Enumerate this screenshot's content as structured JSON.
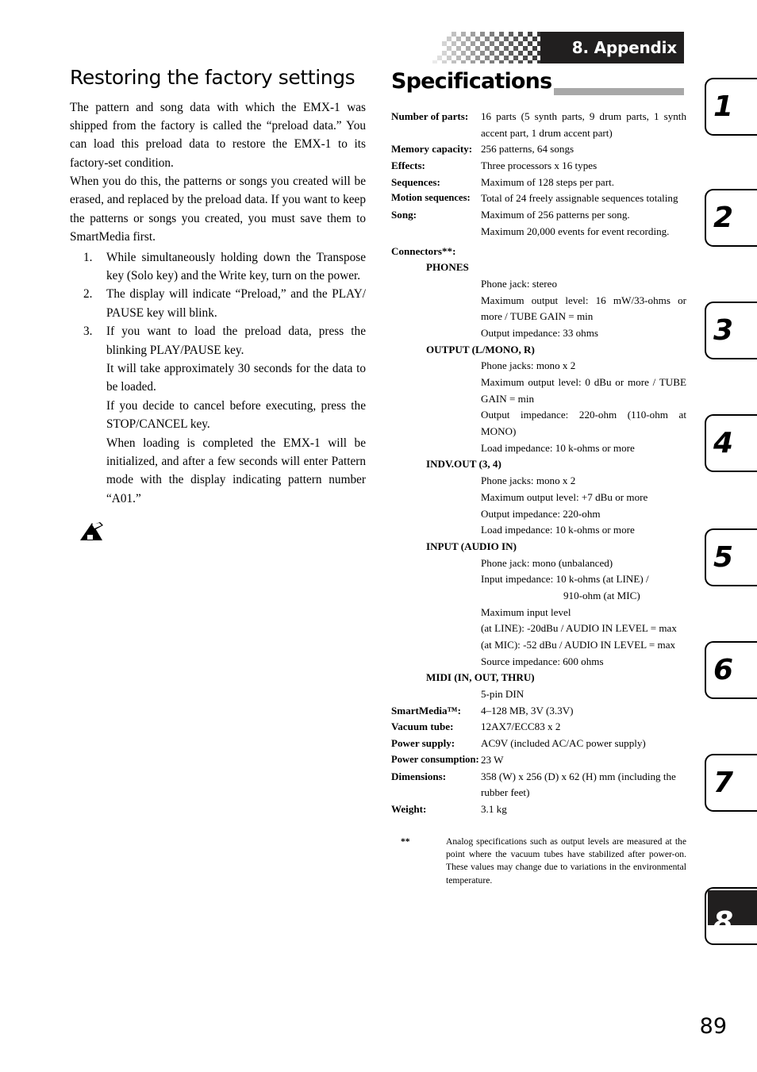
{
  "page": {
    "number": "89"
  },
  "chapter_banner": {
    "title": "8. Appendix"
  },
  "left_column": {
    "heading": "Restoring the factory settings",
    "paragraphs": [
      "The pattern and song data with which the EMX-1 was shipped from the factory is called the “preload data.” You can load this preload data to restore the EMX-1 to its factory-set condition.",
      "When you do this, the patterns or songs you created will be erased, and replaced by the preload data. If you want to keep the patterns or songs you created, you must save them to SmartMedia first."
    ],
    "steps": [
      {
        "num": "1.",
        "text": "While simultaneously holding down the Transpose key (Solo key) and the Write key, turn on the power.",
        "sub": []
      },
      {
        "num": "2.",
        "text": "The display will indicate “Preload,” and the PLAY/ PAUSE key will blink.",
        "sub": []
      },
      {
        "num": "3.",
        "text": "If you want to load the preload data, press the blinking PLAY/PAUSE key.",
        "sub": [
          "It will take approximately 30 seconds for the data to be loaded.",
          "If you decide to cancel before executing, press the STOP/CANCEL key.",
          "When loading is completed the EMX-1 will be initialized, and after a few seconds will enter Pattern mode with the display indicating pattern number “A01.”"
        ]
      }
    ],
    "note_icon": "pen-note-icon"
  },
  "right_column": {
    "title": "Specifications",
    "spec_rows": [
      {
        "label": "Number of parts:",
        "value": "16 parts (5 synth parts, 9 drum parts, 1 synth accent part, 1 drum accent part)"
      },
      {
        "label": "Memory capacity:",
        "value": "256 patterns, 64 songs"
      },
      {
        "label": "Effects:",
        "value": "Three processors x 16 types"
      },
      {
        "label": "Sequences:",
        "value": "Maximum of 128 steps per part."
      },
      {
        "label": "Motion sequences:",
        "value": "Total of 24 freely assignable sequences totaling"
      },
      {
        "label": "Song:",
        "value": "Maximum of 256 patterns per song.",
        "continuation": "Maximum 20,000 events for event recording."
      }
    ],
    "connectors_label": "Connectors**:",
    "connectors": [
      {
        "name": "PHONES",
        "details": [
          "Phone jack: stereo",
          "Maximum output level: 16 mW/33-ohms or more / TUBE GAIN = min",
          "Output impedance: 33 ohms"
        ]
      },
      {
        "name": "OUTPUT (L/MONO, R)",
        "details": [
          "Phone jacks: mono x 2",
          "Maximum output level: 0 dBu or more / TUBE GAIN = min",
          "Output impedance: 220-ohm (110-ohm at MONO)",
          "Load impedance: 10 k-ohms or more"
        ]
      },
      {
        "name": "INDV.OUT (3, 4)",
        "details": [
          "Phone jacks: mono x 2",
          "Maximum output level: +7 dBu or more",
          "Output impedance: 220-ohm",
          "Load impedance: 10 k-ohms or more"
        ]
      },
      {
        "name": "INPUT (AUDIO IN)",
        "details": [
          "Phone jack: mono (unbalanced)",
          "Input impedance: 10 k-ohms (at LINE) /"
        ],
        "detail_indent": "910-ohm (at MIC)",
        "details_after": [
          "Maximum input level",
          "(at LINE): -20dBu / AUDIO IN LEVEL = max",
          "(at MIC):   -52 dBu / AUDIO IN LEVEL = max",
          "Source impedance: 600 ohms"
        ]
      },
      {
        "name": "MIDI (IN, OUT, THRU)",
        "details": [
          "5-pin DIN"
        ]
      }
    ],
    "spec_rows_tail": [
      {
        "label": "SmartMedia™:",
        "value": "4–128 MB, 3V (3.3V)"
      },
      {
        "label": "Vacuum tube:",
        "value": "12AX7/ECC83 x 2"
      },
      {
        "label": "Power supply:",
        "value": "AC9V (included AC/AC power supply)"
      },
      {
        "label": "Power consumption:",
        "value": "23 W"
      },
      {
        "label": "Dimensions:",
        "value": "358 (W) x 256 (D) x 62 (H) mm (including the",
        "continuation": "rubber feet)"
      },
      {
        "label": "Weight:",
        "value": "3.1 kg"
      }
    ],
    "footnote": {
      "mark": "**",
      "text": "Analog specifications such as output levels are measured at the point where the vacuum tubes have stabilized after power-on. These values may change due to variations in the environmental temperature."
    }
  },
  "chapter_tabs": [
    {
      "label": "1",
      "active": false
    },
    {
      "label": "2",
      "active": false
    },
    {
      "label": "3",
      "active": false
    },
    {
      "label": "4",
      "active": false
    },
    {
      "label": "5",
      "active": false
    },
    {
      "label": "6",
      "active": false
    },
    {
      "label": "7",
      "active": false
    },
    {
      "label": "8",
      "active": true
    }
  ],
  "colors": {
    "bar_black": "#211f1f",
    "rule_gray": "#a8a8a8",
    "page_bg": "#ffffff"
  }
}
